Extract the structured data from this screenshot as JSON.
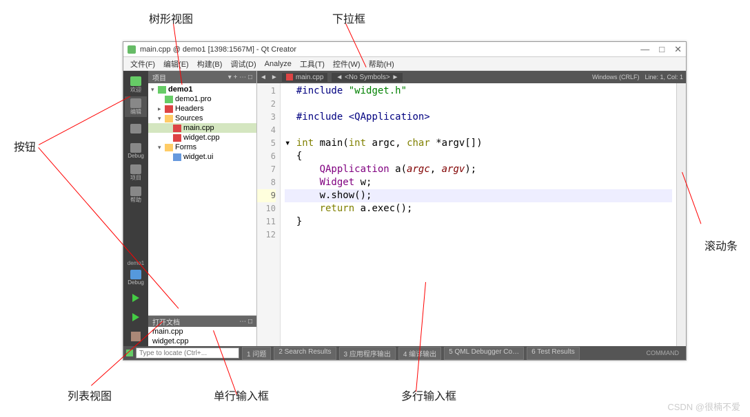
{
  "annotations": {
    "tree_view": "树形视图",
    "dropdown": "下拉框",
    "button": "按钮",
    "scrollbar": "滚动条",
    "list_view": "列表视图",
    "single_line_input": "单行输入框",
    "multi_line_input": "多行输入框"
  },
  "watermark": "CSDN @很楠不爱",
  "window": {
    "title": "main.cpp @ demo1 [1398:1567M] - Qt Creator",
    "controls": {
      "min": "—",
      "max": "□",
      "close": "✕"
    }
  },
  "menubar": [
    "文件(F)",
    "编辑(E)",
    "构建(B)",
    "调试(D)",
    "Analyze",
    "工具(T)",
    "控件(W)",
    "帮助(H)"
  ],
  "leftbar": {
    "items": [
      {
        "label": "欢迎"
      },
      {
        "label": "编辑"
      },
      {
        "label": ""
      },
      {
        "label": "Debug"
      },
      {
        "label": "项目"
      },
      {
        "label": "帮助"
      }
    ],
    "target": "demo1",
    "config": "Debug"
  },
  "project_pane": {
    "header": "项目",
    "tree": [
      {
        "lvl": 0,
        "arrow": "▾",
        "icon": "qt",
        "label": "demo1",
        "bold": true
      },
      {
        "lvl": 1,
        "arrow": "",
        "icon": "qt",
        "label": "demo1.pro"
      },
      {
        "lvl": 1,
        "arrow": "▸",
        "icon": "h",
        "label": "Headers"
      },
      {
        "lvl": 1,
        "arrow": "▾",
        "icon": "folder",
        "label": "Sources"
      },
      {
        "lvl": 2,
        "arrow": "",
        "icon": "cpp",
        "label": "main.cpp",
        "sel": true
      },
      {
        "lvl": 2,
        "arrow": "",
        "icon": "cpp",
        "label": "widget.cpp"
      },
      {
        "lvl": 1,
        "arrow": "▾",
        "icon": "folder",
        "label": "Forms"
      },
      {
        "lvl": 2,
        "arrow": "",
        "icon": "ui",
        "label": "widget.ui"
      }
    ]
  },
  "open_files": {
    "header": "打开文档",
    "items": [
      "main.cpp",
      "widget.cpp"
    ]
  },
  "editor": {
    "tab": "main.cpp",
    "symbols": "<No Symbols>",
    "encoding": "Windows (CRLF)",
    "position": "Line: 1, Col: 1",
    "lines": [
      {
        "n": 1,
        "html": "<span class='kw-pp'>#include</span> <span class='kw-str'>\"widget.h\"</span>",
        "cur": true
      },
      {
        "n": 2,
        "html": ""
      },
      {
        "n": 3,
        "html": "<span class='kw-pp'>#include</span> <span class='kw-inc'>&lt;QApplication&gt;</span>"
      },
      {
        "n": 4,
        "html": ""
      },
      {
        "n": 5,
        "html": "<span class='kw-type'>int</span> <span class='kw-fn'>main</span>(<span class='kw-type'>int</span> argc, <span class='kw-type'>char</span> *argv[])",
        "fold": true
      },
      {
        "n": 6,
        "html": "{"
      },
      {
        "n": 7,
        "html": "    <span class='kw-cls'>QApplication</span> a(<span class='kw-arg'>argc</span>, <span class='kw-arg'>argv</span>);"
      },
      {
        "n": 8,
        "html": "    <span class='kw-cls'>Widget</span> w;"
      },
      {
        "n": 9,
        "html": "    w.show();",
        "hl": true
      },
      {
        "n": 10,
        "html": "    <span class='kw-kw'>return</span> a.exec();"
      },
      {
        "n": 11,
        "html": "}"
      },
      {
        "n": 12,
        "html": ""
      }
    ]
  },
  "statusbar": {
    "locator_placeholder": "Type to locate (Ctrl+...",
    "tabs": [
      "问题",
      "Search Results",
      "应用程序输出",
      "编译输出",
      "QML Debugger Co…",
      "Test Results"
    ],
    "right": "COMMAND"
  }
}
